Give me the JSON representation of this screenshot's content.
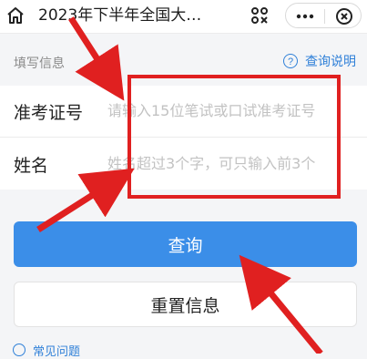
{
  "nav": {
    "title": "2023年下半年全国大…",
    "home_icon": "home-icon",
    "scan_icon": "scan-icon",
    "more_icon": "more-icon",
    "close_icon": "close-icon"
  },
  "section": {
    "label": "填写信息",
    "help_text": "查询说明",
    "help_icon_glyph": "?"
  },
  "form": {
    "exam_no": {
      "label": "准考证号",
      "placeholder": "请输入15位笔试或口试准考证号",
      "value": ""
    },
    "name": {
      "label": "姓名",
      "placeholder": "姓名超过3个字，可只输入前3个",
      "value": ""
    }
  },
  "buttons": {
    "query_label": "查询",
    "reset_label": "重置信息"
  },
  "faq": {
    "text": "常见问题"
  },
  "colors": {
    "accent": "#3b8ee8",
    "annotation": "#e02020"
  }
}
